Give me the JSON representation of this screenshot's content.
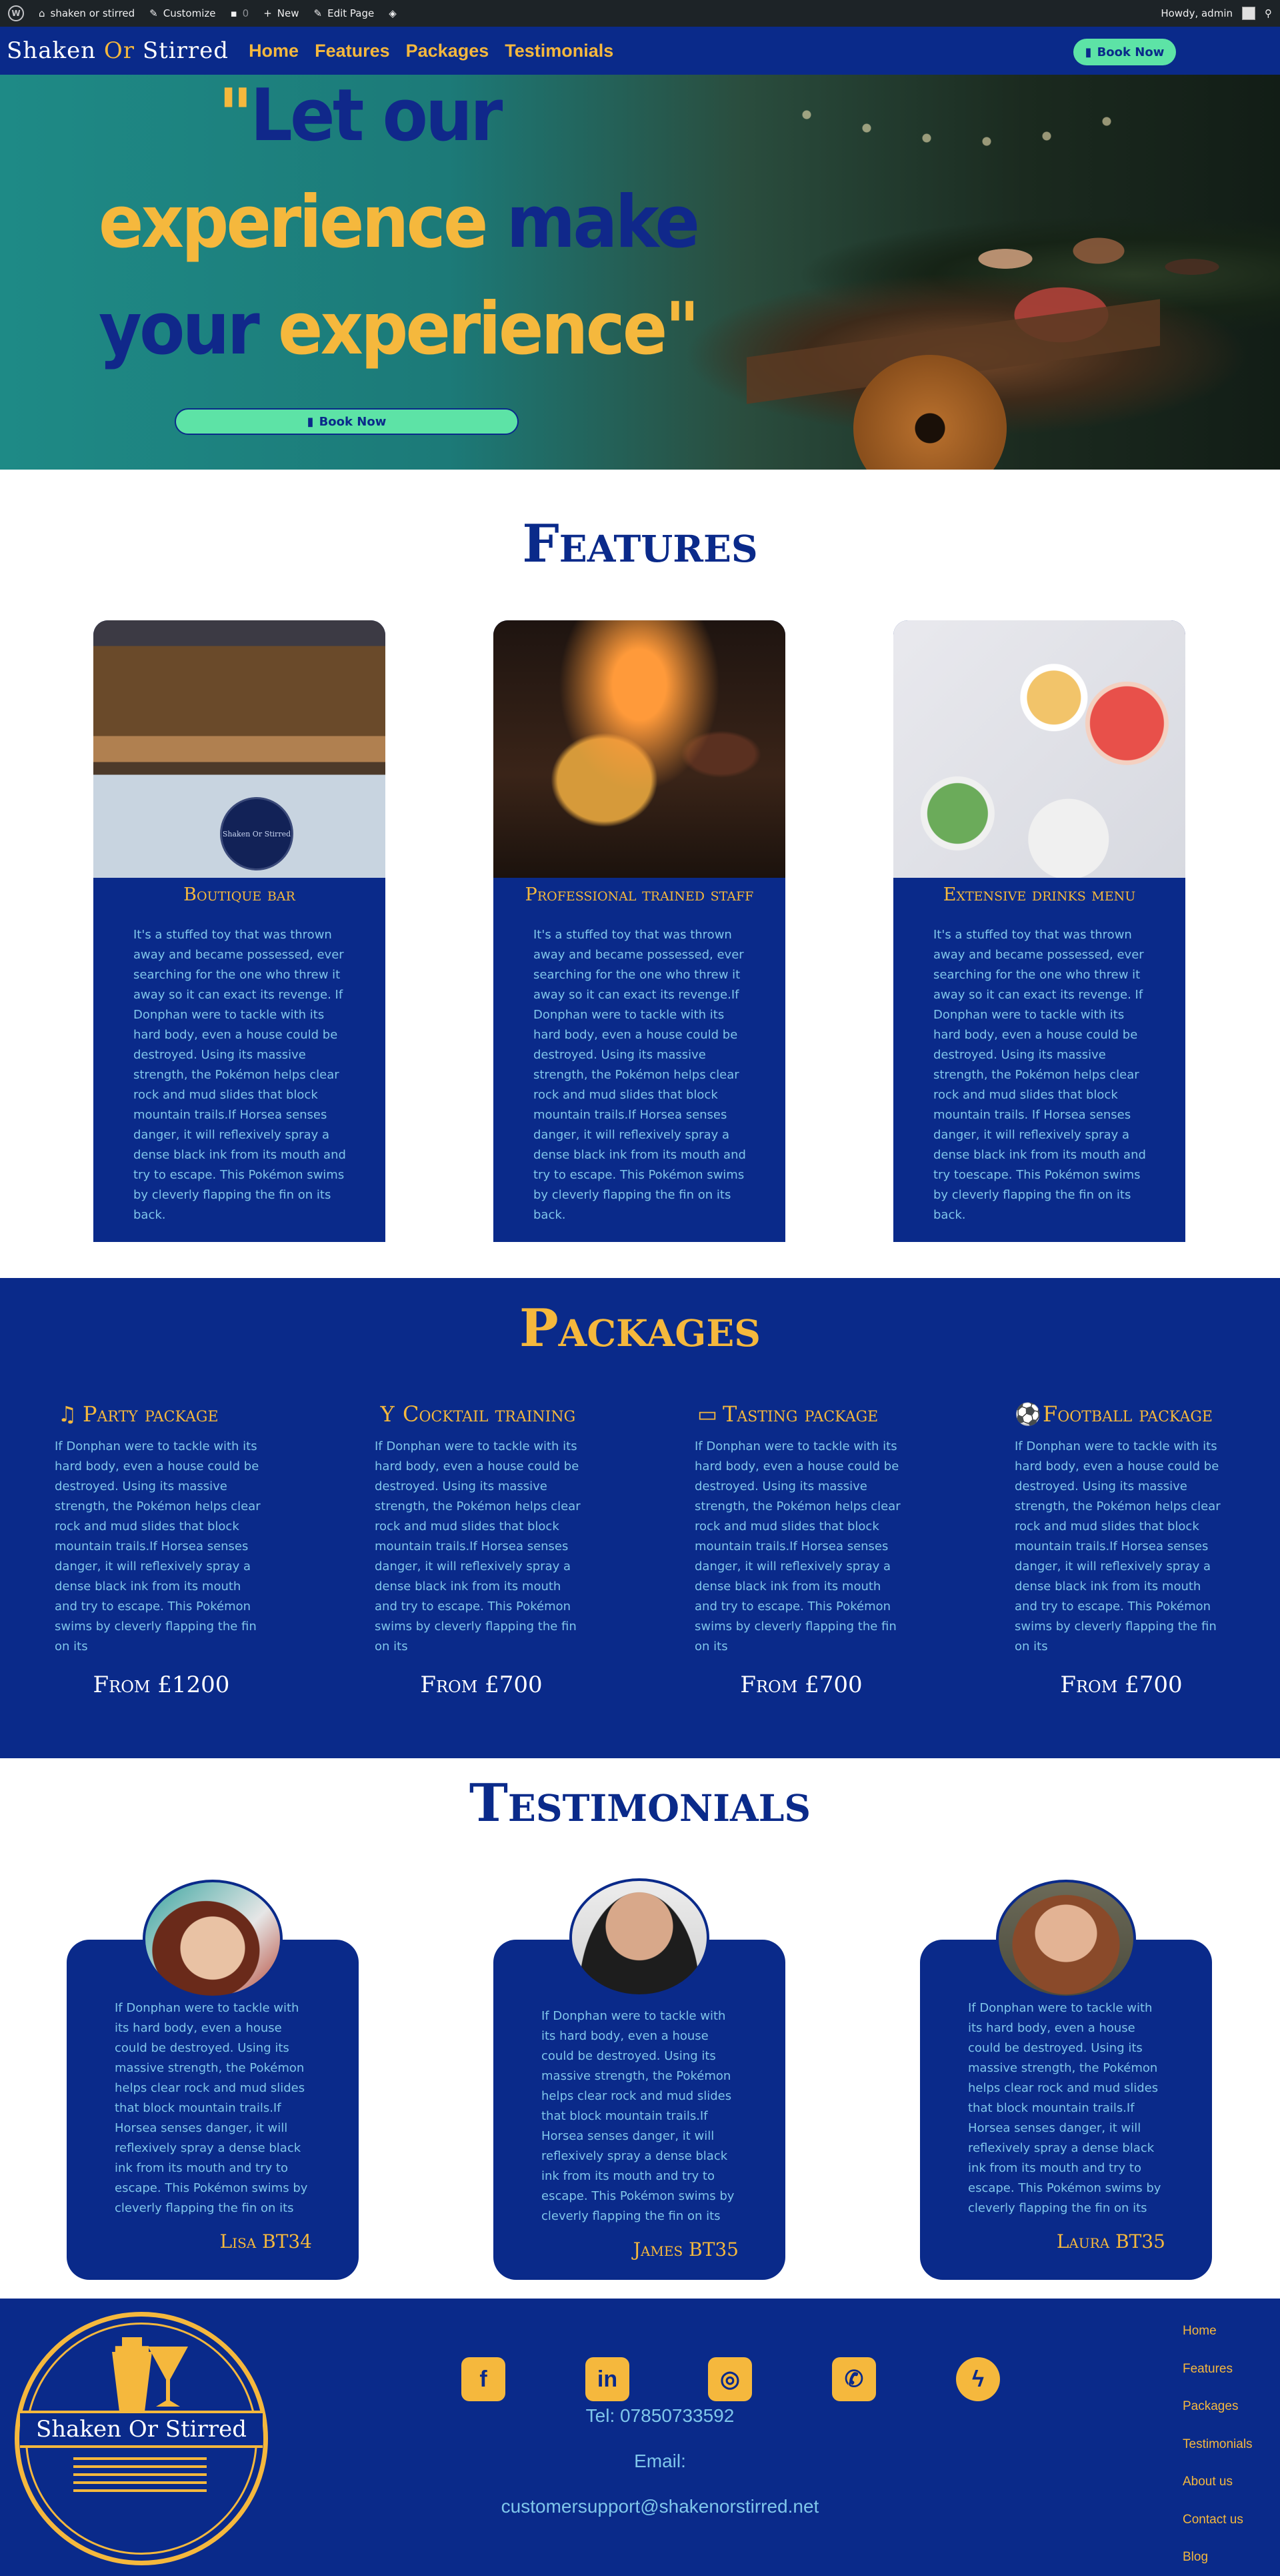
{
  "adminbar": {
    "site_name": "shaken or stirred",
    "customize": "Customize",
    "comments": "0",
    "new": "New",
    "edit_page": "Edit Page",
    "howdy": "Howdy, admin"
  },
  "nav": {
    "brand_pre": "Shaken ",
    "brand_or": "Or",
    "brand_post": " Stirred",
    "items": [
      {
        "label": "Home"
      },
      {
        "label": "Features"
      },
      {
        "label": "Packages"
      },
      {
        "label": "Testimonials"
      }
    ],
    "book_label": "Book Now"
  },
  "hero": {
    "quote_open": "\"",
    "w_let_our": "Let our",
    "w_experience1": "experience",
    "w_make": "make",
    "w_your": "your",
    "w_experience2": "experience",
    "quote_close": "\"",
    "book_label": "Book Now"
  },
  "features": {
    "title": "Features",
    "cards": [
      {
        "title": "Boutique bar",
        "sign": "Shaken Or Stirred",
        "text": "It's a stuffed toy that was thrown away and became possessed, ever searching for the one who threw it away so it can exact its revenge. If Donphan were to tackle with its hard body, even a house could be destroyed. Using its massive strength, the Pokémon helps clear rock and mud slides that block mountain trails.If Horsea senses danger, it will reflexively spray a dense black ink from its mouth and try to escape. This Pokémon swims by cleverly flapping the fin on its back."
      },
      {
        "title": "Professional trained staff",
        "text": "It's a stuffed toy that was thrown away and became possessed, ever searching for the one who threw it away so it can exact its revenge.If Donphan were to tackle with its hard body, even a house could be destroyed. Using its massive strength, the Pokémon helps clear rock and mud slides that block mountain trails.If Horsea senses danger, it will reflexively spray a dense black ink from its mouth and try to escape. This Pokémon swims by cleverly flapping the fin on its back."
      },
      {
        "title": "Extensive drinks menu",
        "text": "It's a stuffed toy that was thrown away and became possessed, ever searching for the one who threw it away so it can exact its revenge. If Donphan were to tackle with its hard body, even a house could be destroyed. Using its massive strength, the Pokémon helps clear rock and mud slides that block mountain trails. If Horsea senses danger, it will reflexively spray a dense black ink from its mouth and try toescape. This Pokémon swims by cleverly flapping the fin on its back."
      }
    ]
  },
  "packages": {
    "title": "Packages",
    "items": [
      {
        "icon": "party-icon",
        "title": "Party package",
        "text": "If Donphan were to tackle with its hard body, even a house could be destroyed. Using its massive strength, the Pokémon helps clear rock and mud slides that block mountain trails.If Horsea senses danger, it will reflexively spray a dense black ink from its mouth and try to escape. This Pokémon swims by cleverly flapping the fin on its",
        "price": "From £1200"
      },
      {
        "icon": "cocktail-icon",
        "title": "Cocktail training",
        "text": "If Donphan were to tackle with its hard body, even a house could be destroyed. Using its massive strength, the Pokémon helps clear rock and mud slides that block mountain trails.If Horsea senses danger, it will reflexively spray a dense black ink from its mouth and try to escape. This Pokémon swims by cleverly flapping the fin on its",
        "price": "From £700"
      },
      {
        "icon": "glass-icon",
        "title": "Tasting package",
        "text": "If Donphan were to tackle with its hard body, even a house could be destroyed. Using its massive strength, the Pokémon helps clear rock and mud slides that block mountain trails.If Horsea senses danger, it will reflexively spray a dense black ink from its mouth and try to escape. This Pokémon swims by cleverly flapping the fin on its",
        "price": "From £700"
      },
      {
        "icon": "football-icon",
        "title": "Football package",
        "text": "If Donphan were to tackle with its hard body, even a house could be destroyed. Using its massive strength, the Pokémon helps clear rock and mud slides that block mountain trails.If Horsea senses danger, it will reflexively spray a dense black ink from its mouth and try to escape. This Pokémon swims by cleverly flapping the fin on its",
        "price": "From £700"
      }
    ]
  },
  "testimonials": {
    "title": "Testimonials",
    "items": [
      {
        "name": "Lisa BT34",
        "text": "If Donphan were to tackle with its hard body, even a house could be destroyed. Using its massive strength, the Pokémon helps clear rock and mud slides that block mountain trails.If Horsea senses danger, it will reflexively spray a dense black ink from its mouth and try to escape. This Pokémon swims by cleverly flapping the fin on its"
      },
      {
        "name": "James BT35",
        "text": "If Donphan were to tackle with its hard body, even a house could be destroyed. Using its massive strength, the Pokémon helps clear rock and mud slides that block mountain trails.If Horsea senses danger, it will reflexively spray a dense black ink from its mouth and try to escape. This Pokémon swims by cleverly flapping the fin on its"
      },
      {
        "name": "Laura BT35",
        "text": "If Donphan were to tackle with its hard body, even a house could be destroyed. Using its massive strength, the Pokémon helps clear rock and mud slides that block mountain trails.If Horsea senses danger, it will reflexively spray a dense black ink from its mouth and try to escape. This Pokémon swims by cleverly flapping the fin on its"
      }
    ]
  },
  "footer": {
    "logo_text": "Shaken Or Stirred",
    "social": [
      {
        "icon": "facebook-icon"
      },
      {
        "icon": "linkedin-icon"
      },
      {
        "icon": "instagram-icon"
      },
      {
        "icon": "whatsapp-icon"
      },
      {
        "icon": "messenger-icon"
      }
    ],
    "tel": "Tel: 07850733592",
    "email_label": "Email:",
    "email": "customersupport@shakenorstirred.net",
    "menu": [
      {
        "label": "Home"
      },
      {
        "label": "Features"
      },
      {
        "label": "Packages"
      },
      {
        "label": "Testimonials"
      },
      {
        "label": "About us"
      },
      {
        "label": "Contact us"
      },
      {
        "label": "Blog"
      }
    ]
  },
  "colors": {
    "navy": "#0a2a8a",
    "gold": "#f5b83d",
    "mint": "#5de3a6",
    "lightblue": "#7fc6ea"
  }
}
